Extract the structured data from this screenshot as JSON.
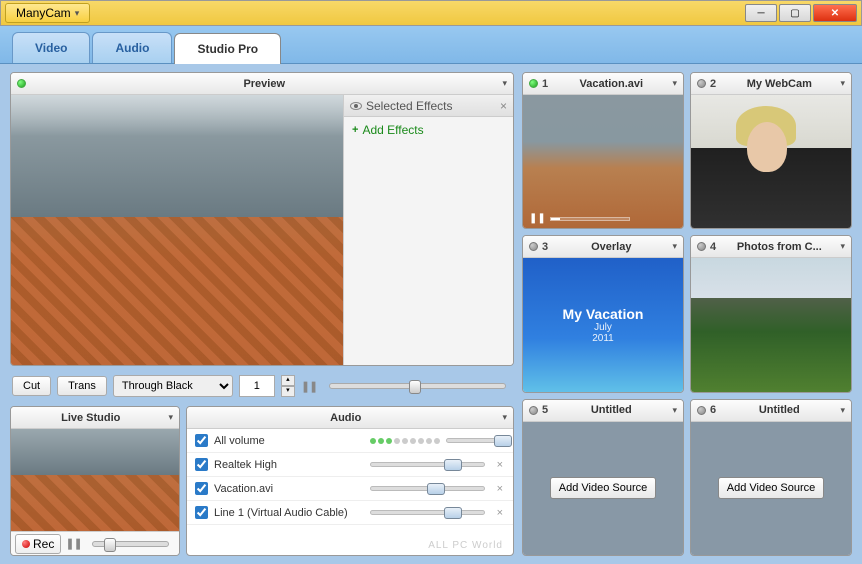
{
  "app": {
    "title": "ManyCam"
  },
  "tabs": [
    {
      "label": "Video",
      "active": false
    },
    {
      "label": "Audio",
      "active": false
    },
    {
      "label": "Studio Pro",
      "active": true
    }
  ],
  "preview": {
    "title": "Preview",
    "effects_title": "Selected Effects",
    "add_effects": "Add Effects",
    "cut_btn": "Cut",
    "trans_btn": "Trans",
    "transition_mode": "Through Black",
    "duration": "1"
  },
  "live_studio": {
    "title": "Live Studio",
    "rec": "Rec"
  },
  "audio": {
    "title": "Audio",
    "rows": [
      {
        "label": "All volume",
        "checked": true,
        "has_dots": true,
        "slider": 88
      },
      {
        "label": "Realtek High",
        "checked": true,
        "slider": 65
      },
      {
        "label": "Vacation.avi",
        "checked": true,
        "slider": 50
      },
      {
        "label": "Line 1 (Virtual Audio Cable)",
        "checked": true,
        "slider": 65
      }
    ]
  },
  "sources": [
    {
      "num": "1",
      "title": "Vacation.avi",
      "kind": "town",
      "active": true,
      "playing": true
    },
    {
      "num": "2",
      "title": "My WebCam",
      "kind": "cam",
      "active": false
    },
    {
      "num": "3",
      "title": "Overlay",
      "kind": "overlay",
      "active": false,
      "ov_title": "My Vacation",
      "ov_month": "July",
      "ov_year": "2011"
    },
    {
      "num": "4",
      "title": "Photos from C...",
      "kind": "photos",
      "active": false
    },
    {
      "num": "5",
      "title": "Untitled",
      "kind": "empty",
      "active": false
    },
    {
      "num": "6",
      "title": "Untitled",
      "kind": "empty",
      "active": false
    }
  ],
  "add_source_btn": "Add Video Source",
  "watermark": "ALL PC World"
}
